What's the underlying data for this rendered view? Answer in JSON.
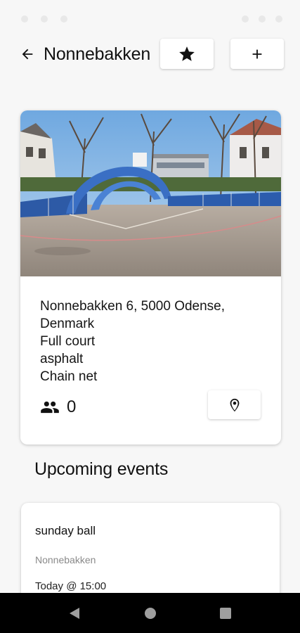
{
  "header": {
    "title": "Nonnebakken",
    "back_icon": "arrow-left-icon",
    "favorite_icon": "star-icon",
    "add_icon": "plus-icon"
  },
  "court": {
    "address_line1": "Nonnebakken 6, 5000 Odense,",
    "address_line2": "Denmark",
    "court_type": "Full court",
    "surface": "asphalt",
    "net": "Chain net",
    "players_icon": "people-icon",
    "players_count": "0",
    "location_icon": "map-pin-icon"
  },
  "events_section": {
    "title": "Upcoming events",
    "events": [
      {
        "name": "sunday ball",
        "place": "Nonnebakken",
        "time": "Today @ 15:00"
      }
    ]
  },
  "nav": {
    "back_icon": "triangle-back-icon",
    "home_icon": "circle-home-icon",
    "recents_icon": "square-recents-icon"
  },
  "colors": {
    "background": "#f7f7f7",
    "card": "#ffffff",
    "text": "#111111",
    "muted": "#8a8a8a",
    "nav_bar": "#000000"
  }
}
